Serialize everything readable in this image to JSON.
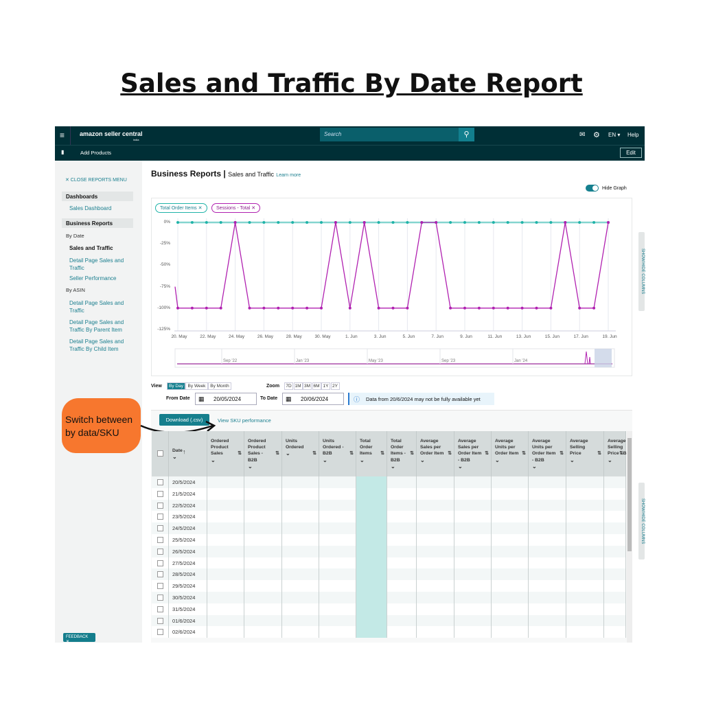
{
  "page_title": "Sales and Traffic By Date Report",
  "topbar": {
    "logo": "amazon seller central",
    "logo_sub": "india",
    "search_placeholder": "Search",
    "lang": "EN ▾",
    "help": "Help",
    "mail_icon": "mail-icon",
    "gear_icon": "gear-icon"
  },
  "subbar": {
    "bookmark": "Add Products",
    "edit": "Edit"
  },
  "sidebar": {
    "close": "✕ CLOSE REPORTS MENU",
    "dashboards": "Dashboards",
    "sales_dashboard": "Sales Dashboard",
    "business_reports": "Business Reports",
    "by_date": "By Date",
    "by_date_items": [
      "Sales and Traffic",
      "Detail Page Sales and Traffic",
      "Seller Performance"
    ],
    "by_asin": "By ASIN",
    "by_asin_items": [
      "Detail Page Sales and Traffic",
      "Detail Page Sales and Traffic By Parent Item",
      "Detail Page Sales and Traffic By Child Item"
    ],
    "feedback": "FEEDBACK ✕"
  },
  "header": {
    "title": "Business Reports",
    "separator": "|",
    "subtitle": "Sales and Traffic",
    "learn_more": "Learn more",
    "hide_graph": "Hide Graph",
    "hide_graph_on": true
  },
  "chips": [
    {
      "label": "Total Order Items ✕",
      "color": "#1fb3a8"
    },
    {
      "label": "Sessions - Total ✕",
      "color": "#b020b0"
    }
  ],
  "chart_data": {
    "type": "line",
    "ylim": [
      -125,
      0
    ],
    "yticks": [
      "0%",
      "-25%",
      "-50%",
      "-75%",
      "-100%",
      "-125%"
    ],
    "ytick_values": [
      0,
      -25,
      -50,
      -75,
      -100,
      -125
    ],
    "x": [
      "20 May",
      "21 May",
      "22 May",
      "23 May",
      "24 May",
      "25 May",
      "26 May",
      "27 May",
      "28 May",
      "29 May",
      "30 May",
      "31 May",
      "1 Jun",
      "2 Jun",
      "3 Jun",
      "4 Jun",
      "5 Jun",
      "6 Jun",
      "7 Jun",
      "8 Jun",
      "9 Jun",
      "10 Jun",
      "11 Jun",
      "12 Jun",
      "13 Jun",
      "14 Jun",
      "15 Jun",
      "16 Jun",
      "17 Jun",
      "18 Jun",
      "19 Jun"
    ],
    "xticks": [
      "20. May",
      "22. May",
      "24. May",
      "26. May",
      "28. May",
      "30. May",
      "1. Jun",
      "3. Jun",
      "5. Jun",
      "7. Jun",
      "9. Jun",
      "11. Jun",
      "13. Jun",
      "15. Jun",
      "17. Jun",
      "19. Jun"
    ],
    "series": [
      {
        "name": "Total Order Items",
        "color": "#1fb3a8",
        "values": [
          0,
          0,
          0,
          0,
          0,
          0,
          0,
          0,
          0,
          0,
          0,
          0,
          0,
          0,
          0,
          0,
          0,
          0,
          0,
          0,
          0,
          0,
          0,
          0,
          0,
          0,
          0,
          0,
          0,
          0,
          0
        ]
      },
      {
        "name": "Sessions - Total",
        "color": "#b020b0",
        "values": [
          -100,
          -100,
          -100,
          -100,
          0,
          -100,
          -100,
          -100,
          -100,
          -100,
          -100,
          0,
          -100,
          0,
          -100,
          -100,
          -100,
          0,
          0,
          -100,
          -100,
          -100,
          -100,
          -100,
          -100,
          -100,
          -100,
          0,
          -100,
          -100,
          0
        ]
      }
    ],
    "navigator_labels": [
      "Sep '22",
      "Jan '23",
      "May '23",
      "Sep '23",
      "Jan '24"
    ],
    "grid": true
  },
  "controls": {
    "view": "View",
    "view_options": [
      "By Day",
      "By Week",
      "By Month"
    ],
    "view_selected": "By Day",
    "zoom": "Zoom",
    "zoom_options": [
      "7D",
      "1M",
      "3M",
      "6M",
      "1Y",
      "2Y"
    ],
    "from_label": "From Date",
    "from_value": "20/05/2024",
    "to_label": "To Date",
    "to_value": "20/06/2024",
    "notice": "Data from 20/6/2024 may not be fully available yet"
  },
  "download": "Download (.csv)",
  "view_sku": "View SKU performance",
  "callout": "Switch between by data/SKU",
  "table": {
    "columns": [
      "Date",
      "Ordered Product Sales",
      "Ordered Product Sales - B2B",
      "Units Ordered",
      "Units Ordered - B2B",
      "Total Order Items",
      "Total Order Items - B2B",
      "Average Sales per Order Item",
      "Average Sales per Order Item - B2B",
      "Average Units per Order Item",
      "Average Units per Order Item - B2B",
      "Average Selling Price",
      "Average Selling Price - B"
    ],
    "rows": [
      "20/5/2024",
      "21/5/2024",
      "22/5/2024",
      "23/5/2024",
      "24/5/2024",
      "25/5/2024",
      "26/5/2024",
      "27/5/2024",
      "28/5/2024",
      "29/5/2024",
      "30/5/2024",
      "31/5/2024",
      "01/6/2024",
      "02/6/2024"
    ]
  },
  "show_hide_columns": "SHOW/HIDE COLUMNS"
}
